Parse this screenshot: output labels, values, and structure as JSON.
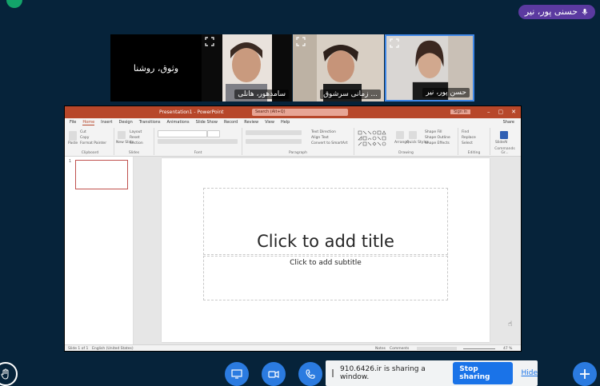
{
  "user_badge": {
    "name": "حسنی پور، نیر"
  },
  "tiles": [
    {
      "name": "وثوق، روشنا",
      "type": "avatar-name"
    },
    {
      "name": "سامدهور، هانلی"
    },
    {
      "name": "زمانی سرشوق ..."
    },
    {
      "name": "حسن پور، نیر"
    }
  ],
  "powerpoint": {
    "window_title": "Presentation1 - PowerPoint",
    "search_placeholder": "Search (Alt+Q)",
    "signin": "Sign in",
    "tabs": [
      "File",
      "Home",
      "Insert",
      "Design",
      "Transitions",
      "Animations",
      "Slide Show",
      "Record",
      "Review",
      "View",
      "Help"
    ],
    "active_tab": "Home",
    "share": "Share",
    "ribbon_groups": [
      "Clipboard",
      "Slides",
      "Font",
      "Paragraph",
      "Drawing",
      "Editing",
      "Commands Gr..."
    ],
    "ribbon": {
      "paste": "Paste",
      "cut": "Cut",
      "copy": "Copy",
      "format_painter": "Format Painter",
      "new_slide": "New Slide",
      "layout": "Layout",
      "reset": "Reset",
      "section": "Section",
      "text_direction": "Text Direction",
      "align_text": "Align Text",
      "convert_smartart": "Convert to SmartArt",
      "arrange": "Arrange",
      "quick_styles": "Quick Styles",
      "shape_fill": "Shape Fill",
      "shape_outline": "Shape Outline",
      "shape_effects": "Shape Effects",
      "find": "Find",
      "replace": "Replace",
      "select": "Select",
      "slideai": "SlideAI"
    },
    "slide_number": "1",
    "title_placeholder": "Click to add title",
    "subtitle_placeholder": "Click to add subtitle",
    "status": {
      "slide": "Slide 1 of 1",
      "language": "English (United States)",
      "notes": "Notes",
      "comments": "Comments",
      "zoom": "47 %"
    }
  },
  "share_bar": {
    "message": "910.6426.ir is sharing a window.",
    "stop": "Stop sharing",
    "hide": "Hide"
  },
  "colors": {
    "background": "#06233a",
    "ppt_accent": "#b7472a",
    "button_blue": "#2b7be0",
    "badge_purple": "#5b3aa0"
  }
}
